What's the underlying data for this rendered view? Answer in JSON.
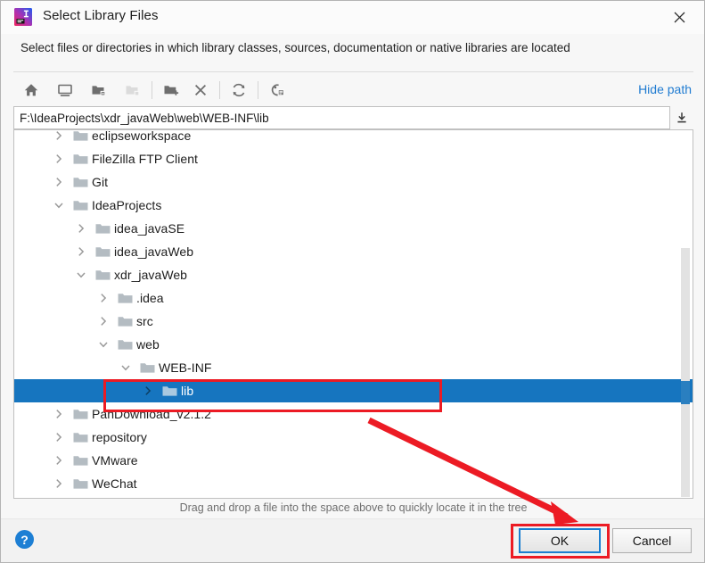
{
  "window": {
    "title": "Select Library Files",
    "app_icon": "intellij-idea-icon",
    "close_icon": "close-icon"
  },
  "description": "Select files or directories in which library classes, sources, documentation or native libraries are located",
  "toolbar": {
    "buttons": [
      {
        "name": "home-icon",
        "tooltip": "Home",
        "enabled": true
      },
      {
        "name": "desktop-icon",
        "tooltip": "Desktop",
        "enabled": true
      },
      {
        "name": "folder-expanded-icon",
        "tooltip": "Project",
        "enabled": true
      },
      {
        "name": "folder-disabled-icon",
        "tooltip": "Module",
        "enabled": false
      },
      {
        "name": "new-folder-icon",
        "tooltip": "New Folder",
        "enabled": true
      },
      {
        "name": "delete-icon",
        "tooltip": "Delete",
        "enabled": true
      },
      {
        "name": "refresh-icon",
        "tooltip": "Refresh",
        "enabled": true
      },
      {
        "name": "show-hidden-files-icon",
        "tooltip": "Show Hidden Files and Directories",
        "enabled": true
      }
    ],
    "hide_path_label": "Hide path"
  },
  "path_field": {
    "value": "F:\\IdeaProjects\\xdr_javaWeb\\web\\WEB-INF\\lib",
    "placeholder": "",
    "dropdown_icon": "download-arrow-icon"
  },
  "tree": {
    "items": [
      {
        "label": "eclipseworkspace",
        "depth": 1,
        "state": "collapsed",
        "selected": false
      },
      {
        "label": "FileZilla FTP Client",
        "depth": 1,
        "state": "collapsed",
        "selected": false
      },
      {
        "label": "Git",
        "depth": 1,
        "state": "collapsed",
        "selected": false
      },
      {
        "label": "IdeaProjects",
        "depth": 1,
        "state": "expanded",
        "selected": false
      },
      {
        "label": "idea_javaSE",
        "depth": 2,
        "state": "collapsed",
        "selected": false
      },
      {
        "label": "idea_javaWeb",
        "depth": 2,
        "state": "collapsed",
        "selected": false
      },
      {
        "label": "xdr_javaWeb",
        "depth": 2,
        "state": "expanded",
        "selected": false
      },
      {
        "label": ".idea",
        "depth": 3,
        "state": "collapsed",
        "selected": false
      },
      {
        "label": "src",
        "depth": 3,
        "state": "collapsed",
        "selected": false
      },
      {
        "label": "web",
        "depth": 3,
        "state": "expanded",
        "selected": false
      },
      {
        "label": "WEB-INF",
        "depth": 4,
        "state": "expanded",
        "selected": false
      },
      {
        "label": "lib",
        "depth": 5,
        "state": "collapsed",
        "selected": true
      },
      {
        "label": "PanDownload_v2.1.2",
        "depth": 1,
        "state": "collapsed",
        "selected": false
      },
      {
        "label": "repository",
        "depth": 1,
        "state": "collapsed",
        "selected": false
      },
      {
        "label": "VMware",
        "depth": 1,
        "state": "collapsed",
        "selected": false
      },
      {
        "label": "WeChat",
        "depth": 1,
        "state": "collapsed",
        "selected": false
      }
    ],
    "selection_color": "#1675bf",
    "folder_icon": "folder-icon",
    "scrollbar": {
      "name": "vertical-scrollbar",
      "thumb_color": "#e2e2e2"
    }
  },
  "hint": "Drag and drop a file into the space above to quickly locate it in the tree",
  "footer": {
    "help_label": "?",
    "ok_label": "OK",
    "cancel_label": "Cancel"
  },
  "annotations": {
    "color": "#ec1b24",
    "rect_lib": "highlight-lib-folder",
    "rect_ok": "highlight-ok-button",
    "arrow": "arrow-pointing-to-ok"
  }
}
